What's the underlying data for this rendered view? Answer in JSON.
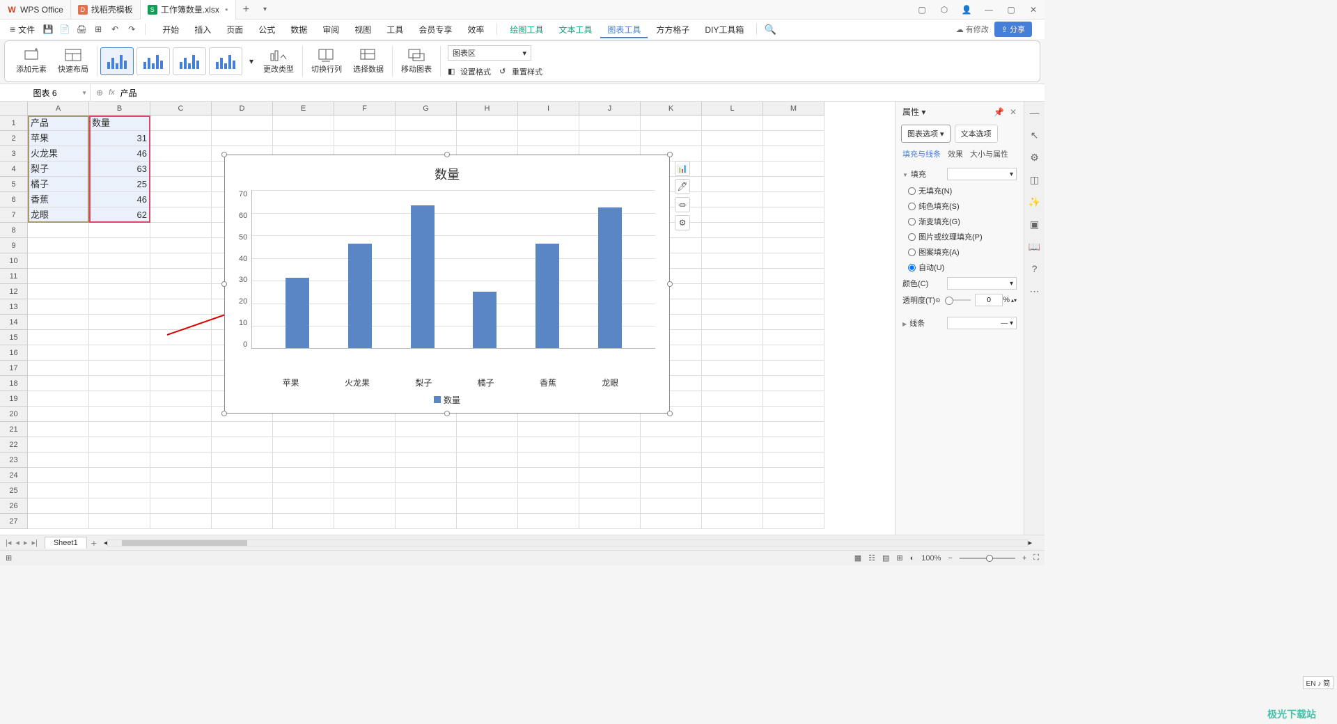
{
  "titlebar": {
    "app_name": "WPS Office",
    "tab2": "找稻壳模板",
    "tab3": "工作簿数量.xlsx"
  },
  "menubar": {
    "file": "文件",
    "tabs": [
      "开始",
      "插入",
      "页面",
      "公式",
      "数据",
      "审阅",
      "视图",
      "工具",
      "会员专享",
      "效率"
    ],
    "tool_tabs": [
      "绘图工具",
      "文本工具",
      "图表工具",
      "方方格子",
      "DIY工具箱"
    ],
    "active_tool": "图表工具",
    "cloud": "有修改",
    "share": "分享"
  },
  "ribbon": {
    "add_element": "添加元素",
    "quick_layout": "快速布局",
    "change_type": "更改类型",
    "switch_rc": "切换行列",
    "select_data": "选择数据",
    "move_chart": "移动图表",
    "area_label": "图表区",
    "set_format": "设置格式",
    "reset_style": "重置样式"
  },
  "formula_bar": {
    "name": "图表 6",
    "fx": "fx",
    "value": "产品"
  },
  "grid": {
    "cols": [
      "A",
      "B",
      "C",
      "D",
      "E",
      "F",
      "G",
      "H",
      "I",
      "J",
      "K",
      "L",
      "M"
    ],
    "header": {
      "A": "产品",
      "B": "数量"
    },
    "data": [
      {
        "A": "苹果",
        "B": "31"
      },
      {
        "A": "火龙果",
        "B": "46"
      },
      {
        "A": "梨子",
        "B": "63"
      },
      {
        "A": "橘子",
        "B": "25"
      },
      {
        "A": "香蕉",
        "B": "46"
      },
      {
        "A": "龙眼",
        "B": "62"
      }
    ]
  },
  "chart_data": {
    "type": "bar",
    "title": "数量",
    "categories": [
      "苹果",
      "火龙果",
      "梨子",
      "橘子",
      "香蕉",
      "龙眼"
    ],
    "values": [
      31,
      46,
      63,
      25,
      46,
      62
    ],
    "ylim": [
      0,
      70
    ],
    "yticks": [
      "70",
      "60",
      "50",
      "40",
      "30",
      "20",
      "10",
      "0"
    ],
    "legend": "数量"
  },
  "prop_panel": {
    "title": "属性",
    "tab1": "图表选项",
    "tab2": "文本选项",
    "sub1": "填充与线条",
    "sub2": "效果",
    "sub3": "大小与属性",
    "fill_h": "填充",
    "fills": [
      "无填充(N)",
      "纯色填充(S)",
      "渐变填充(G)",
      "图片或纹理填充(P)",
      "图案填充(A)",
      "自动(U)"
    ],
    "color": "颜色(C)",
    "opacity": "透明度(T)",
    "opacity_val": "0",
    "opacity_unit": "%",
    "line_h": "线条"
  },
  "sheet_tabs": {
    "sheet1": "Sheet1"
  },
  "statusbar": {
    "zoom": "100%",
    "ime": "EN ♪ 简"
  },
  "watermark": "极光下载站"
}
